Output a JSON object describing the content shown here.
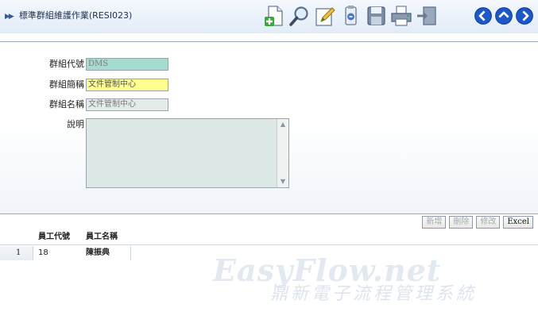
{
  "header": {
    "title": "標準群組維護作業(RESI023)"
  },
  "toolbar": {
    "icons": [
      "new-doc-icon",
      "search-icon",
      "edit-icon",
      "clear-icon",
      "save-icon",
      "print-icon",
      "exit-icon",
      "back-icon",
      "up-icon",
      "forward-icon"
    ]
  },
  "form": {
    "group_code_label": "群組代號",
    "group_code_value": "DMS",
    "group_short_label": "群組簡稱",
    "group_short_value": "文件管制中心",
    "group_name_label": "群組名稱",
    "group_name_value": "文件管制中心",
    "description_label": "說明",
    "description_value": ""
  },
  "buttons": {
    "add": "新增",
    "delete": "刪除",
    "modify": "修改",
    "excel": "Excel"
  },
  "grid": {
    "columns": [
      "員工代號",
      "員工名稱"
    ],
    "rows": [
      {
        "num": "1",
        "emp_id": "18",
        "emp_name": "陳振典"
      }
    ]
  },
  "watermark": {
    "brand": "EasyFlow.net",
    "tagline": "鼎新電子流程管理系統"
  },
  "colors": {
    "field_teal": "#a6dccf",
    "field_yellow": "#ffff90",
    "field_gray": "#e4ece9",
    "header_bg": "#e2ecf8"
  }
}
